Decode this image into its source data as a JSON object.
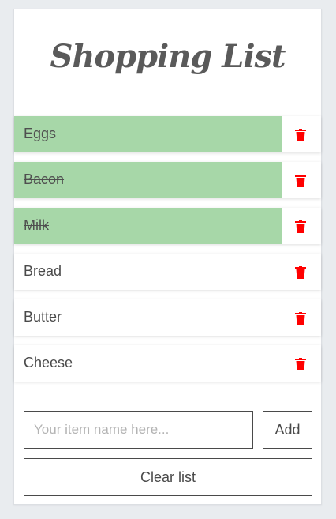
{
  "app": {
    "title": "Shopping List"
  },
  "colors": {
    "done_background": "#a7d7a8",
    "trash_icon": "#ff0000",
    "title_text": "#5a5a5a"
  },
  "items": [
    {
      "label": "Eggs",
      "done": true,
      "icon": "trash-icon"
    },
    {
      "label": "Bacon",
      "done": true,
      "icon": "trash-icon"
    },
    {
      "label": "Milk",
      "done": true,
      "icon": "trash-icon"
    },
    {
      "label": "Bread",
      "done": false,
      "icon": "trash-icon"
    },
    {
      "label": "Butter",
      "done": false,
      "icon": "trash-icon"
    },
    {
      "label": "Cheese",
      "done": false,
      "icon": "trash-icon"
    }
  ],
  "form": {
    "input_value": "",
    "input_placeholder": "Your item name here...",
    "add_label": "Add",
    "clear_label": "Clear list"
  }
}
